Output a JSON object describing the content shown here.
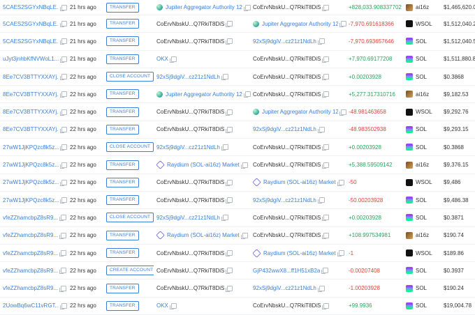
{
  "transactions": [
    {
      "sig": "5CAES2SGYxNBqLE...",
      "time": "21 hrs ago",
      "action": "TRANSFER",
      "from": "Jupiter Aggregator Authority 12",
      "from_type": "jup",
      "to": "CoErvNbskU...Q7RkiT8DiS",
      "to_type": "plain",
      "amount": "+828,033.908337702",
      "sign": "pos",
      "token": "ai16z",
      "token_icon": "ai16z",
      "value": "$1,465,620.01"
    },
    {
      "sig": "5CAES2SGYxNBqLE...",
      "time": "21 hrs ago",
      "action": "TRANSFER",
      "from": "CoErvNbskU...Q7RkiT8DiS",
      "from_type": "plain",
      "to": "Jupiter Aggregator Authority 12",
      "to_type": "jup",
      "amount": "-7,970.691618366",
      "sign": "neg",
      "token": "WSOL",
      "token_icon": "wsol",
      "value": "$1,512,040.2"
    },
    {
      "sig": "5CAES2SGYxNBqLE...",
      "time": "21 hrs ago",
      "action": "TRANSFER",
      "from": "CoErvNbskU...Q7RkiT8DiS",
      "from_type": "plain",
      "to": "92xSj9dgiV...cz21z1NdLh",
      "to_type": "link",
      "amount": "-7,970.693657646",
      "sign": "neg",
      "token": "SOL",
      "token_icon": "sol",
      "value": "$1,512,040.58"
    },
    {
      "sig": "uJyt3jnhbKfNVWoL1...",
      "time": "21 hrs ago",
      "action": "TRANSFER",
      "from": "OKX",
      "from_type": "link",
      "to": "CoErvNbskU...Q7RkiT8DiS",
      "to_type": "plain",
      "amount": "+7,970.69177208",
      "sign": "pos",
      "token": "SOL",
      "token_icon": "sol",
      "value": "$1,511,880.81"
    },
    {
      "sig": "8Ee7CV3BTTYXXAYj...",
      "time": "22 hrs ago",
      "action": "CLOSE ACCOUNT",
      "from": "92xSj9dgiV...cz21z1NdLh",
      "from_type": "link",
      "to": "CoErvNbskU...Q7RkiT8DiS",
      "to_type": "plain",
      "amount": "+0.00203928",
      "sign": "pos",
      "token": "SOL",
      "token_icon": "sol",
      "value": "$0.3868"
    },
    {
      "sig": "8Ee7CV3BTTYXXAYj...",
      "time": "22 hrs ago",
      "action": "TRANSFER",
      "from": "Jupiter Aggregator Authority 12",
      "from_type": "jup",
      "to": "CoErvNbskU...Q7RkiT8DiS",
      "to_type": "plain",
      "amount": "+5,277.317310716",
      "sign": "pos",
      "token": "ai16z",
      "token_icon": "ai16z",
      "value": "$9,182.53"
    },
    {
      "sig": "8Ee7CV3BTTYXXAYj...",
      "time": "22 hrs ago",
      "action": "TRANSFER",
      "from": "CoErvNbskU...Q7RkiT8DiS",
      "from_type": "plain",
      "to": "Jupiter Aggregator Authority 12",
      "to_type": "jup",
      "amount": "-48.981463658",
      "sign": "neg",
      "token": "WSOL",
      "token_icon": "wsol",
      "value": "$9,292.76"
    },
    {
      "sig": "8Ee7CV3BTTYXXAYj...",
      "time": "22 hrs ago",
      "action": "TRANSFER",
      "from": "CoErvNbskU...Q7RkiT8DiS",
      "from_type": "plain",
      "to": "92xSj9dgiV...cz21z1NdLh",
      "to_type": "link",
      "amount": "-48.983502938",
      "sign": "neg",
      "token": "SOL",
      "token_icon": "sol",
      "value": "$9,293.15"
    },
    {
      "sig": "27wW1JjKPQzc8k5z...",
      "time": "22 hrs ago",
      "action": "CLOSE ACCOUNT",
      "from": "92xSj9dgiV...cz21z1NdLh",
      "from_type": "link",
      "to": "CoErvNbskU...Q7RkiT8DiS",
      "to_type": "plain",
      "amount": "+0.00203928",
      "sign": "pos",
      "token": "SOL",
      "token_icon": "sol",
      "value": "$0.3868"
    },
    {
      "sig": "27wW1JjKPQzc8k5z...",
      "time": "22 hrs ago",
      "action": "TRANSFER",
      "from": "Raydium (SOL-ai16z) Market",
      "from_type": "ray",
      "to": "CoErvNbskU...Q7RkiT8DiS",
      "to_type": "plain",
      "amount": "+5,388.59509142",
      "sign": "pos",
      "token": "ai16z",
      "token_icon": "ai16z",
      "value": "$9,376.15"
    },
    {
      "sig": "27wW1JjKPQzc8k5z...",
      "time": "22 hrs ago",
      "action": "TRANSFER",
      "from": "CoErvNbskU...Q7RkiT8DiS",
      "from_type": "plain",
      "to": "Raydium (SOL-ai16z) Market",
      "to_type": "ray",
      "amount": "-50",
      "sign": "neg",
      "token": "WSOL",
      "token_icon": "wsol",
      "value": "$9,486"
    },
    {
      "sig": "27wW1JjKPQzc8k5z...",
      "time": "22 hrs ago",
      "action": "TRANSFER",
      "from": "CoErvNbskU...Q7RkiT8DiS",
      "from_type": "plain",
      "to": "92xSj9dgiV...cz21z1NdLh",
      "to_type": "link",
      "amount": "-50.00203928",
      "sign": "neg",
      "token": "SOL",
      "token_icon": "sol",
      "value": "$9,486.38"
    },
    {
      "sig": "vfeZZhamcbpZ8sR9...",
      "time": "22 hrs ago",
      "action": "CLOSE ACCOUNT",
      "from": "92xSj9dgiV...cz21z1NdLh",
      "from_type": "link",
      "to": "CoErvNbskU...Q7RkiT8DiS",
      "to_type": "plain",
      "amount": "+0.00203928",
      "sign": "pos",
      "token": "SOL",
      "token_icon": "sol",
      "value": "$0.3871"
    },
    {
      "sig": "vfeZZhamcbpZ8sR9...",
      "time": "22 hrs ago",
      "action": "TRANSFER",
      "from": "Raydium (SOL-ai16z) Market",
      "from_type": "ray",
      "to": "CoErvNbskU...Q7RkiT8DiS",
      "to_type": "plain",
      "amount": "+108.997534981",
      "sign": "pos",
      "token": "ai16z",
      "token_icon": "ai16z",
      "value": "$190.74"
    },
    {
      "sig": "vfeZZhamcbpZ8sR9...",
      "time": "22 hrs ago",
      "action": "TRANSFER",
      "from": "CoErvNbskU...Q7RkiT8DiS",
      "from_type": "plain",
      "to": "Raydium (SOL-ai16z) Market",
      "to_type": "ray",
      "amount": "-1",
      "sign": "neg",
      "token": "WSOL",
      "token_icon": "wsol",
      "value": "$189.86"
    },
    {
      "sig": "vfeZZhamcbpZ8sR9...",
      "time": "22 hrs ago",
      "action": "CREATE ACCOUNT",
      "from": "CoErvNbskU...Q7RkiT8DiS",
      "from_type": "plain",
      "to": "GjP432wwX8...ff1H51xB2a",
      "to_type": "link",
      "amount": "-0.00207408",
      "sign": "neg",
      "token": "SOL",
      "token_icon": "sol",
      "value": "$0.3937"
    },
    {
      "sig": "vfeZZhamcbpZ8sR9...",
      "time": "22 hrs ago",
      "action": "TRANSFER",
      "from": "CoErvNbskU...Q7RkiT8DiS",
      "from_type": "plain",
      "to": "92xSj9dgiV...cz21z1NdLh",
      "to_type": "link",
      "amount": "-1.00203928",
      "sign": "neg",
      "token": "SOL",
      "token_icon": "sol",
      "value": "$190.24"
    },
    {
      "sig": "2UowBq6wC11vRGT...",
      "time": "22 hrs ago",
      "action": "TRANSFER",
      "from": "OKX",
      "from_type": "link",
      "to": "CoErvNbskU...Q7RkiT8DiS",
      "to_type": "plain",
      "amount": "+99.9936",
      "sign": "pos",
      "token": "SOL",
      "token_icon": "sol",
      "value": "$19,004.78"
    }
  ],
  "colors": {
    "link": "#3a7fd8",
    "positive": "#2aa35a",
    "negative": "#d9453b"
  }
}
